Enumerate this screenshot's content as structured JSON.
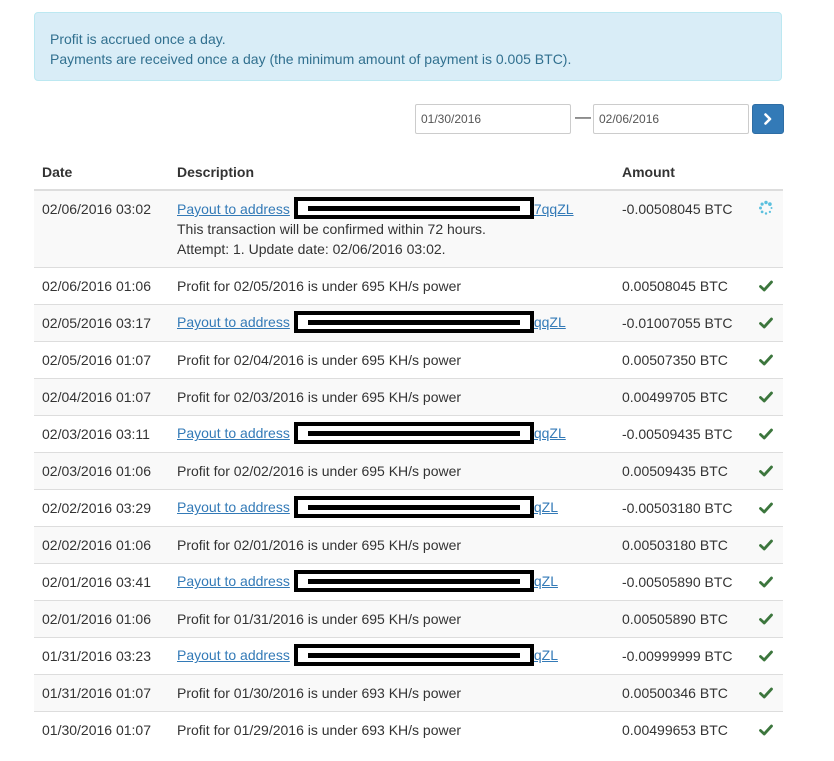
{
  "alert": {
    "line1": "Profit is accrued once a day.",
    "line2": "Payments are received once a day (the minimum amount of payment is 0.005 BTC)."
  },
  "filter": {
    "date_from": "01/30/2016",
    "separator": "—",
    "date_to": "02/06/2016",
    "go_icon": "chevron-right-icon"
  },
  "table": {
    "headers": {
      "date": "Date",
      "description": "Description",
      "amount": "Amount"
    },
    "rows": [
      {
        "date": "02/06/2016 03:02",
        "type": "payout",
        "link": "Payout to address",
        "tail": "7qqZL",
        "note1": "This transaction will be confirmed within 72 hours.",
        "note2": "Attempt: 1. Update date: 02/06/2016 03:02.",
        "amount": "-0.00508045 BTC",
        "status": "pending"
      },
      {
        "date": "02/06/2016 01:06",
        "type": "profit",
        "text": "Profit for 02/05/2016 is under 695 KH/s power",
        "amount": "0.00508045 BTC",
        "status": "done"
      },
      {
        "date": "02/05/2016 03:17",
        "type": "payout",
        "link": "Payout to address",
        "tail": "qqZL",
        "amount": "-0.01007055 BTC",
        "status": "done"
      },
      {
        "date": "02/05/2016 01:07",
        "type": "profit",
        "text": "Profit for 02/04/2016 is under 695 KH/s power",
        "amount": "0.00507350 BTC",
        "status": "done"
      },
      {
        "date": "02/04/2016 01:07",
        "type": "profit",
        "text": "Profit for 02/03/2016 is under 695 KH/s power",
        "amount": "0.00499705 BTC",
        "status": "done"
      },
      {
        "date": "02/03/2016 03:11",
        "type": "payout",
        "link": "Payout to address",
        "tail": "qqZL",
        "amount": "-0.00509435 BTC",
        "status": "done"
      },
      {
        "date": "02/03/2016 01:06",
        "type": "profit",
        "text": "Profit for 02/02/2016 is under 695 KH/s power",
        "amount": "0.00509435 BTC",
        "status": "done"
      },
      {
        "date": "02/02/2016 03:29",
        "type": "payout",
        "link": "Payout to address",
        "tail": "qZL",
        "amount": "-0.00503180 BTC",
        "status": "done"
      },
      {
        "date": "02/02/2016 01:06",
        "type": "profit",
        "text": "Profit for 02/01/2016 is under 695 KH/s power",
        "amount": "0.00503180 BTC",
        "status": "done"
      },
      {
        "date": "02/01/2016 03:41",
        "type": "payout",
        "link": "Payout to address",
        "tail": "qZL",
        "amount": "-0.00505890 BTC",
        "status": "done"
      },
      {
        "date": "02/01/2016 01:06",
        "type": "profit",
        "text": "Profit for 01/31/2016 is under 695 KH/s power",
        "amount": "0.00505890 BTC",
        "status": "done"
      },
      {
        "date": "01/31/2016 03:23",
        "type": "payout",
        "link": "Payout to address",
        "tail": "qZL",
        "amount": "-0.00999999 BTC",
        "status": "done"
      },
      {
        "date": "01/31/2016 01:07",
        "type": "profit",
        "text": "Profit for 01/30/2016 is under 693 KH/s power",
        "amount": "0.00500346 BTC",
        "status": "done"
      },
      {
        "date": "01/30/2016 01:07",
        "type": "profit",
        "text": "Profit for 01/29/2016 is under 693 KH/s power",
        "amount": "0.00499653 BTC",
        "status": "done"
      }
    ]
  },
  "colors": {
    "alert_bg": "#d9edf7",
    "alert_text": "#31708f",
    "link": "#337ab7",
    "button": "#337ab7",
    "check": "#3c763d",
    "spinner": "#5bc0de"
  },
  "icons": {
    "done": "checkmark-icon",
    "pending": "spinner-icon"
  }
}
